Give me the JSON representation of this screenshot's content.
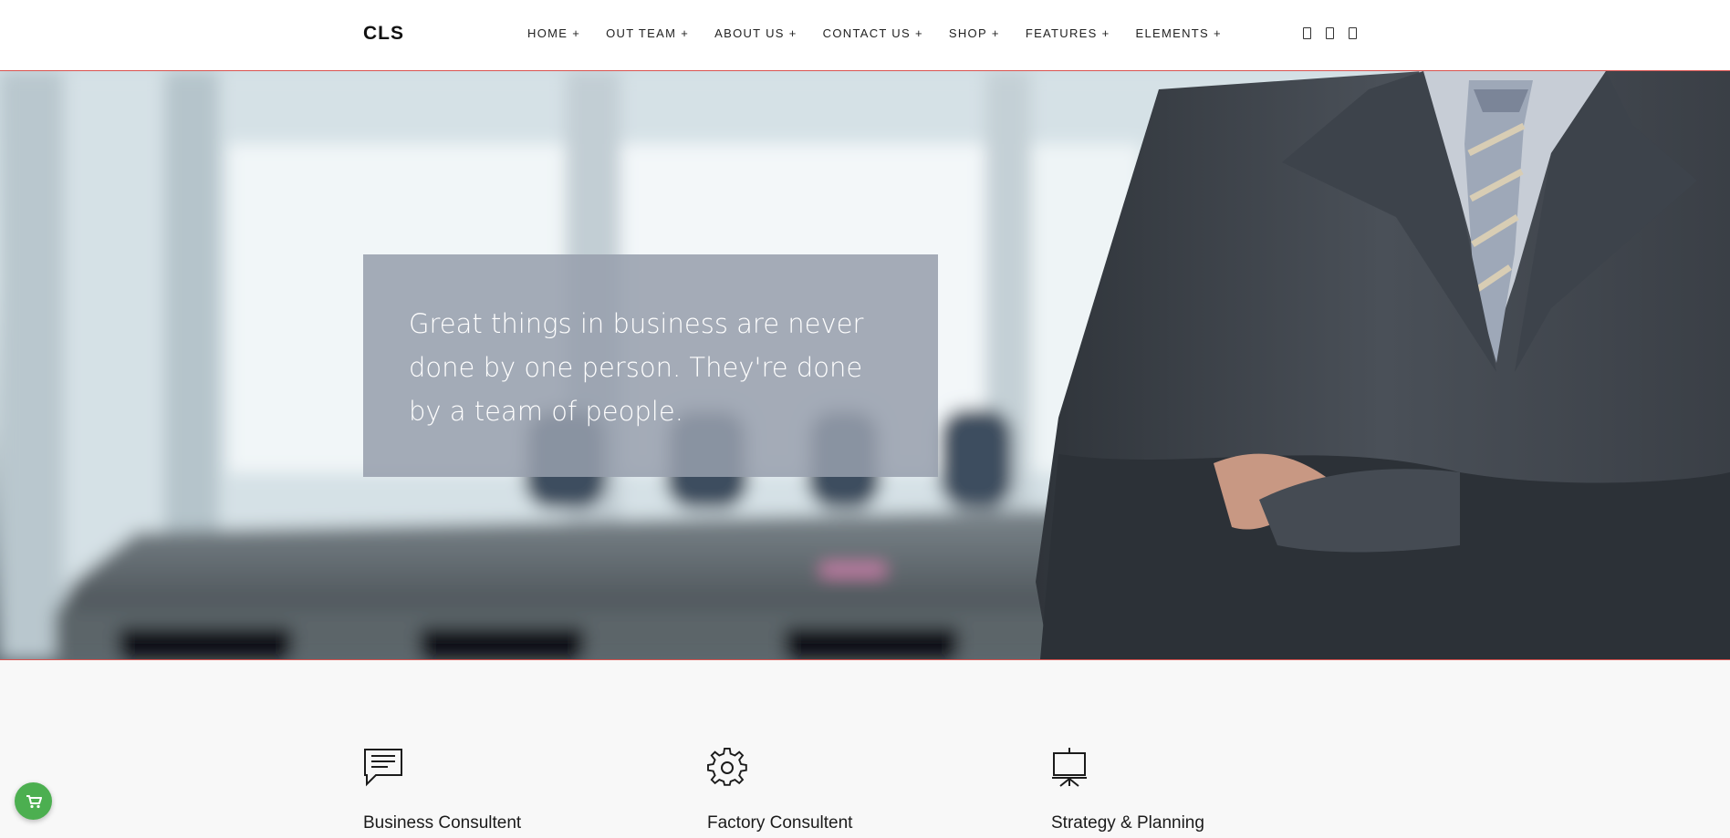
{
  "header": {
    "logo": "CLS",
    "nav": [
      {
        "label": "HOME",
        "suffix": "+"
      },
      {
        "label": "OUT TEAM",
        "suffix": "+"
      },
      {
        "label": "ABOUT US",
        "suffix": "+"
      },
      {
        "label": "CONTACT US",
        "suffix": "+"
      },
      {
        "label": "SHOP",
        "suffix": "+"
      },
      {
        "label": "FEATURES",
        "suffix": "+"
      },
      {
        "label": "ELEMENTS",
        "suffix": "+"
      }
    ],
    "icons": [
      "social-icon",
      "social-icon",
      "social-icon"
    ]
  },
  "hero": {
    "quote": "Great things in business are never done by one person. They're done by a team of people."
  },
  "services": [
    {
      "title": "Business Consultent",
      "icon": "chat-icon"
    },
    {
      "title": "Factory Consultent",
      "icon": "gear-icon"
    },
    {
      "title": "Strategy & Planning",
      "icon": "presentation-board-icon"
    }
  ],
  "colors": {
    "accent_border": "#d9534f",
    "cart_button": "#4caf50",
    "quote_box": "#969eac"
  },
  "cart": {
    "icon": "cart-icon"
  }
}
